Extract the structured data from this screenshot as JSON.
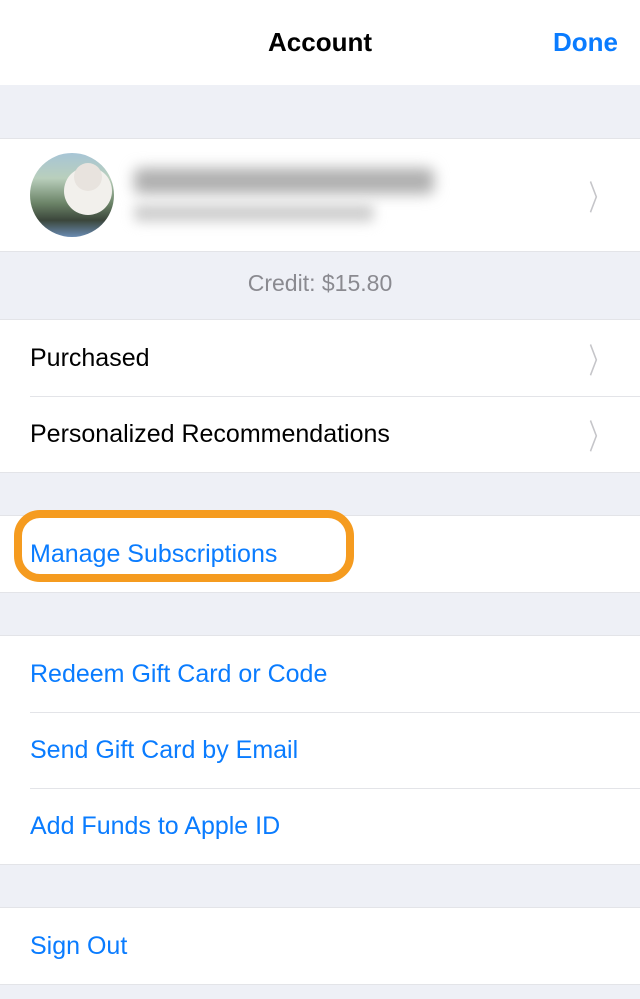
{
  "header": {
    "title": "Account",
    "done": "Done"
  },
  "credit": "Credit: $15.80",
  "rows": {
    "purchased": "Purchased",
    "recommendations": "Personalized Recommendations",
    "manage_subscriptions": "Manage Subscriptions",
    "redeem": "Redeem Gift Card or Code",
    "send_gift": "Send Gift Card by Email",
    "add_funds": "Add Funds to Apple ID",
    "sign_out": "Sign Out"
  }
}
